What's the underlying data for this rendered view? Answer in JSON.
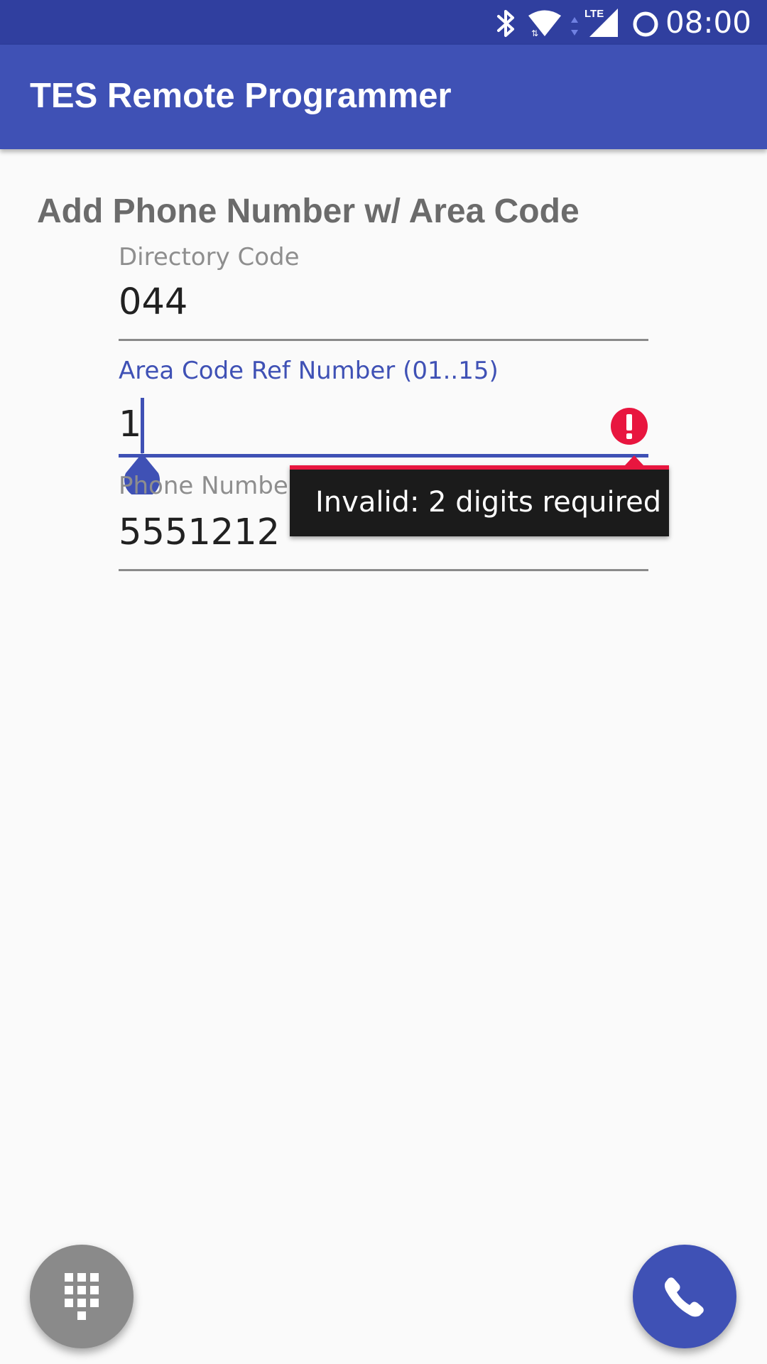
{
  "status_bar": {
    "time": "08:00",
    "icons": [
      "bluetooth-icon",
      "wifi-icon",
      "data-arrows-icon",
      "lte-signal-icon",
      "do-not-disturb-ring-icon"
    ],
    "lte_label": "LTE",
    "color": "#303f9f"
  },
  "app_bar": {
    "title": "TES Remote Programmer",
    "color": "#3f51b5"
  },
  "form": {
    "title": "Add Phone Number w/ Area Code",
    "fields": [
      {
        "label": "Directory Code",
        "value": "044",
        "focused": false
      },
      {
        "label": "Area Code Ref Number (01..15)",
        "value": "1",
        "focused": true,
        "error": true
      },
      {
        "label": "Phone Number",
        "value": "5551212",
        "focused": false
      }
    ]
  },
  "error_popup": {
    "message": "Invalid: 2 digits required",
    "accent_color": "#e8163f"
  },
  "fabs": {
    "dialpad": {
      "icon": "dialpad-icon",
      "color": "#8a8a8a"
    },
    "call": {
      "icon": "phone-icon",
      "color": "#3f51b5"
    }
  },
  "colors": {
    "accent": "#3f51b5",
    "error": "#e8163f",
    "background": "#fafafa"
  }
}
